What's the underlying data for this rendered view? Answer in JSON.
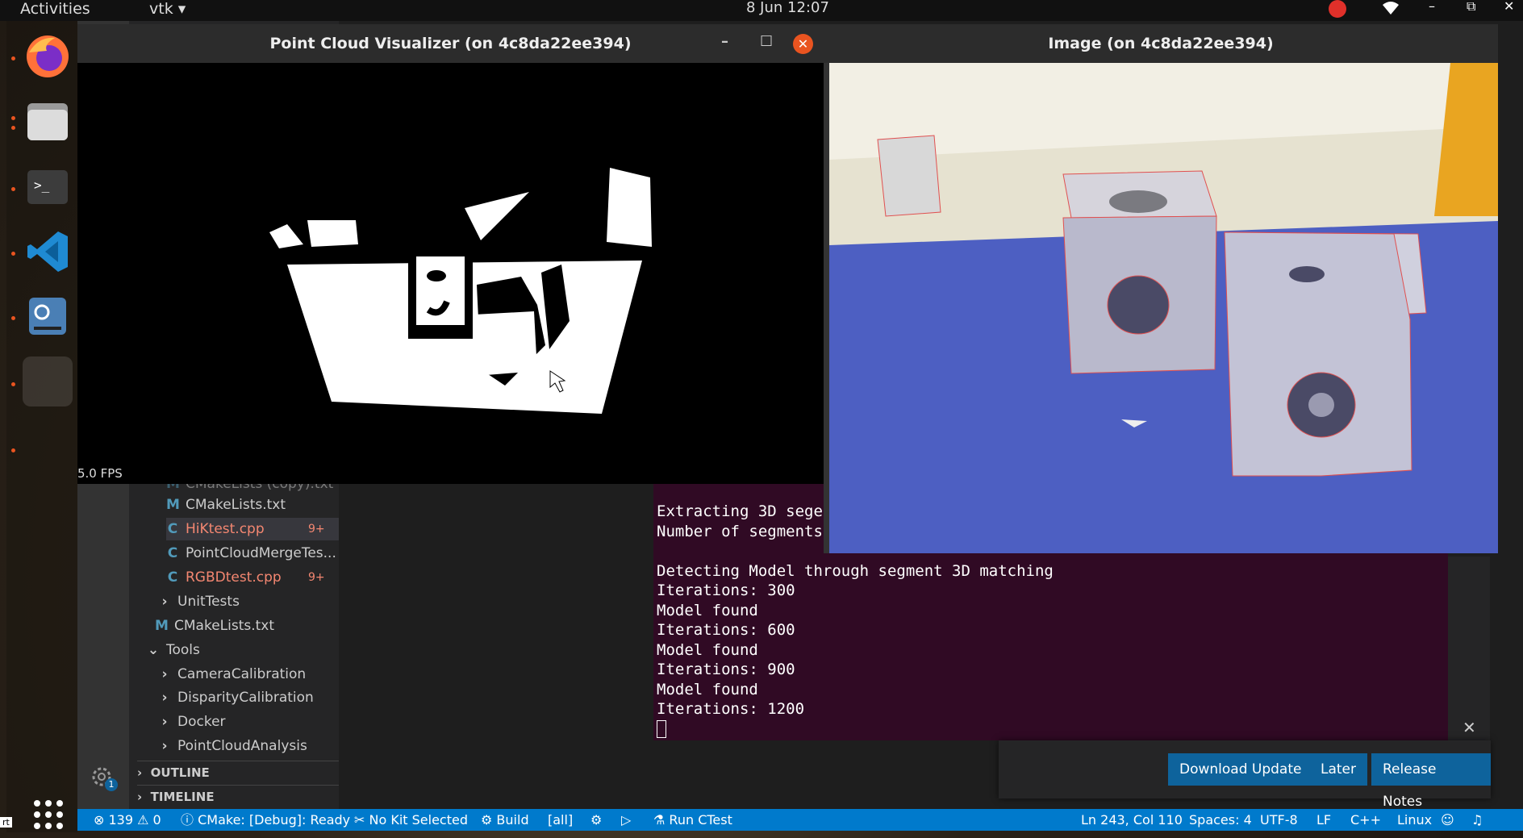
{
  "topbar": {
    "activities": "Activities",
    "app_menu": "vtk",
    "clock": "8 Jun  12:07",
    "minimize": "–",
    "restore": "⧉",
    "close": "✕"
  },
  "dock": {
    "items": [
      "firefox-icon",
      "files-icon",
      "terminal-icon",
      "vscode-icon",
      "settings-app-icon",
      "app-icon"
    ]
  },
  "explorer": {
    "items": [
      {
        "label": "CMakeLists (copy).txt",
        "type": "m"
      },
      {
        "label": "CMakeLists.txt",
        "type": "m"
      },
      {
        "label": "HiKtest.cpp",
        "type": "c",
        "badge": "9+",
        "error": true
      },
      {
        "label": "PointCloudMergeTes...",
        "type": "c"
      },
      {
        "label": "RGBDtest.cpp",
        "type": "c",
        "badge": "9+",
        "error": true
      },
      {
        "label": "UnitTests",
        "type": "folder"
      },
      {
        "label": "CMakeLists.txt",
        "type": "m"
      },
      {
        "label": "Tools",
        "type": "folder-open"
      },
      {
        "label": "CameraCalibration",
        "type": "folder"
      },
      {
        "label": "DisparityCalibration",
        "type": "folder"
      },
      {
        "label": "Docker",
        "type": "folder"
      },
      {
        "label": "PointCloudAnalysis",
        "type": "folder"
      }
    ],
    "outline": "OUTLINE",
    "timeline": "TIMELINE",
    "settings_badge": "1"
  },
  "terminal": {
    "lines": [
      "Extracting 3D sege",
      "Number of segments",
      "",
      "Detecting Model through segment 3D matching",
      "Iterations: 300",
      "Model found",
      "Iterations: 600",
      "Model found",
      "Iterations: 900",
      "Model found",
      "Iterations: 1200"
    ]
  },
  "notification": {
    "download": "Download Update",
    "later": "Later",
    "release_notes": "Release Notes",
    "close": "✕"
  },
  "statusbar": {
    "errors": "⊗ 139 ⚠ 0",
    "cmake": "ⓘ CMake: [Debug]: Ready",
    "kit": "✂ No Kit Selected",
    "build": "⚙ Build",
    "target": "[all]",
    "debug": "⚙",
    "run": "▷",
    "ctest": "⚗ Run CTest",
    "position": "Ln 243, Col 110",
    "spaces": "Spaces: 4",
    "encoding": "UTF-8",
    "eol": "LF",
    "language": "C++",
    "platform": "Linux"
  },
  "pointcloud_window": {
    "title": "Point Cloud Visualizer (on 4c8da22ee394)",
    "minimize": "–",
    "maximize": "☐",
    "close": "✕",
    "fps": "5.0 FPS"
  },
  "image_window": {
    "title": "Image (on 4c8da22ee394)"
  },
  "colors": {
    "accent": "#007acc",
    "terminal_bg": "#300a24",
    "ubuntu_orange": "#e95420",
    "error": "#f48771"
  },
  "corner_label": "rt"
}
